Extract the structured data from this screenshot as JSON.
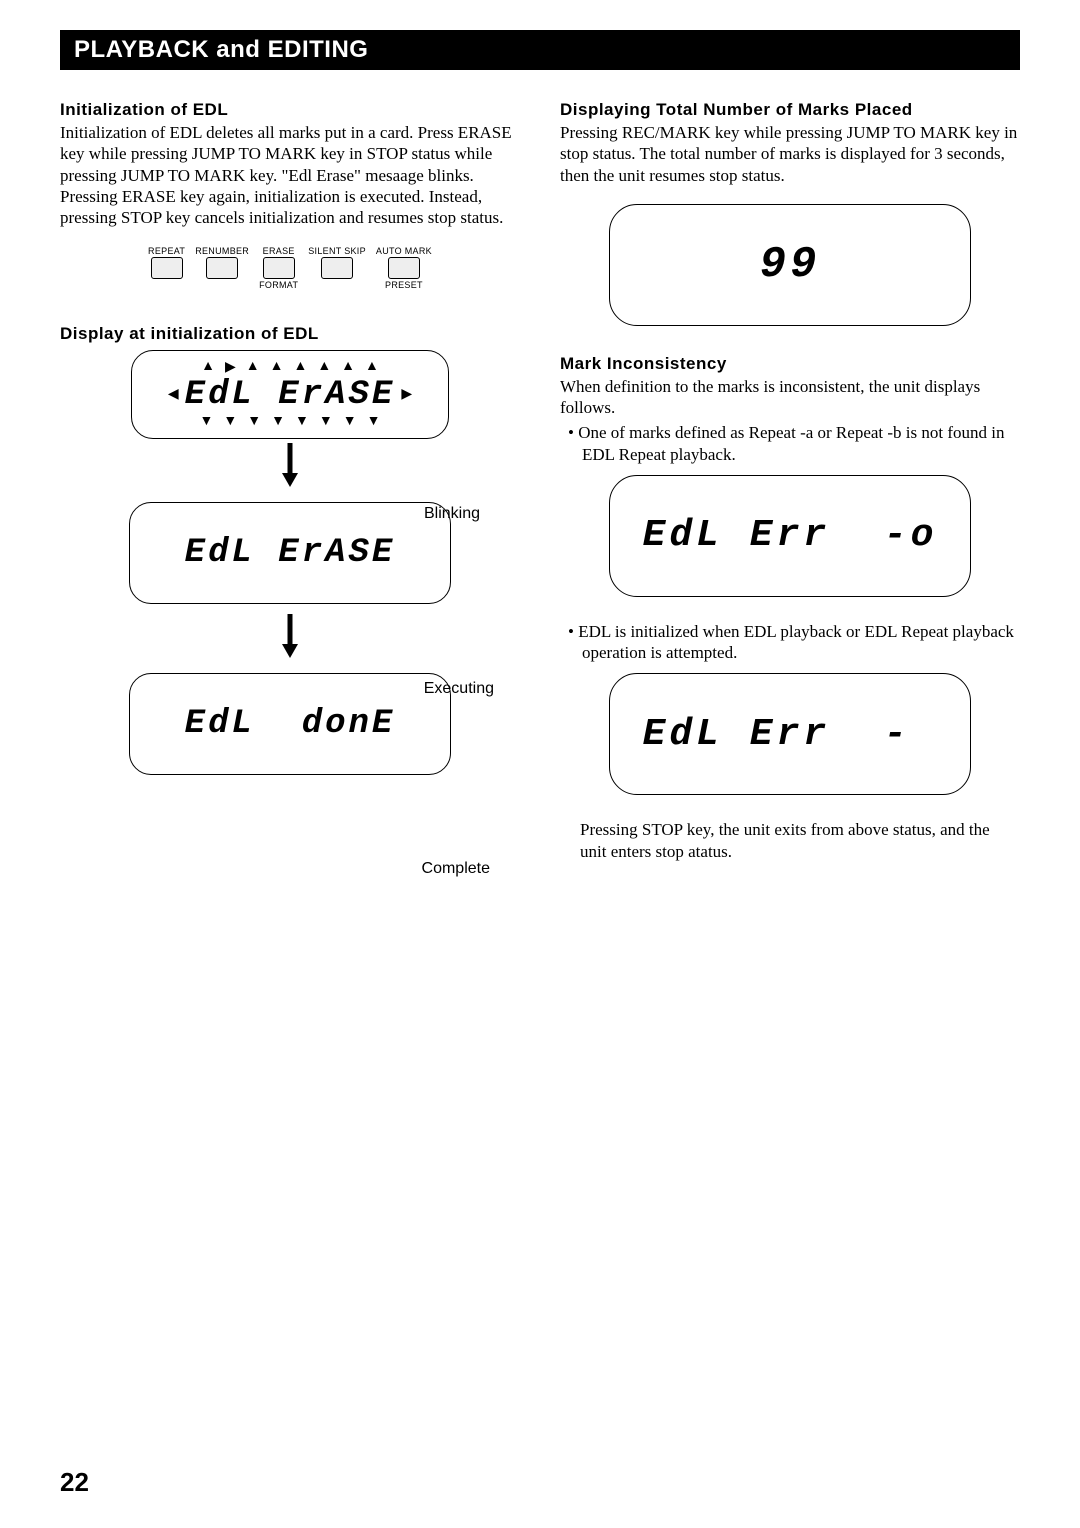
{
  "titleBar": "PLAYBACK and EDITING",
  "left": {
    "head1": "Initialization of EDL",
    "body1": "Initialization of EDL deletes all marks put in a card. Press ERASE key while pressing JUMP TO MARK key in STOP status while pressing JUMP TO MARK key. \"Edl Erase\" mesaage blinks. Pressing ERASE key again, initialization is executed. Instead, pressing STOP key cancels initialization and resumes stop status.",
    "keys": [
      {
        "top": "REPEAT",
        "bot": ""
      },
      {
        "top": "RENUMBER",
        "bot": ""
      },
      {
        "top": "ERASE",
        "bot": "FORMAT"
      },
      {
        "top": "SILENT SKIP",
        "bot": ""
      },
      {
        "top": "AUTO MARK",
        "bot": "PRESET"
      }
    ],
    "head2": "Display at initialization of EDL",
    "lcd1": "EdL ErASE",
    "annot1": "Blinking",
    "lcd2": "EdL ErASE",
    "annot2": "Executing",
    "lcd3": "EdL  donE",
    "annot3": "Complete"
  },
  "right": {
    "head1": "Displaying Total Number of Marks Placed",
    "body1": "Pressing REC/MARK key while pressing JUMP TO MARK key in stop status. The total number of marks is displayed for 3 seconds, then the unit resumes stop status.",
    "lcd1": "99",
    "head2": "Mark Inconsistency",
    "body2": "When definition to the marks is inconsistent, the unit displays follows.",
    "bullet1": "One of marks defined as Repeat -a or Repeat -b is not found in EDL Repeat playback.",
    "lcd2": "EdL Err  -o",
    "bullet2": "EDL is initialized when EDL playback or EDL Repeat playback operation is attempted.",
    "lcd3": "EdL Err  - ",
    "closing": "Pressing STOP key, the unit exits from above status, and the unit enters stop atatus."
  },
  "pageNumber": "22"
}
